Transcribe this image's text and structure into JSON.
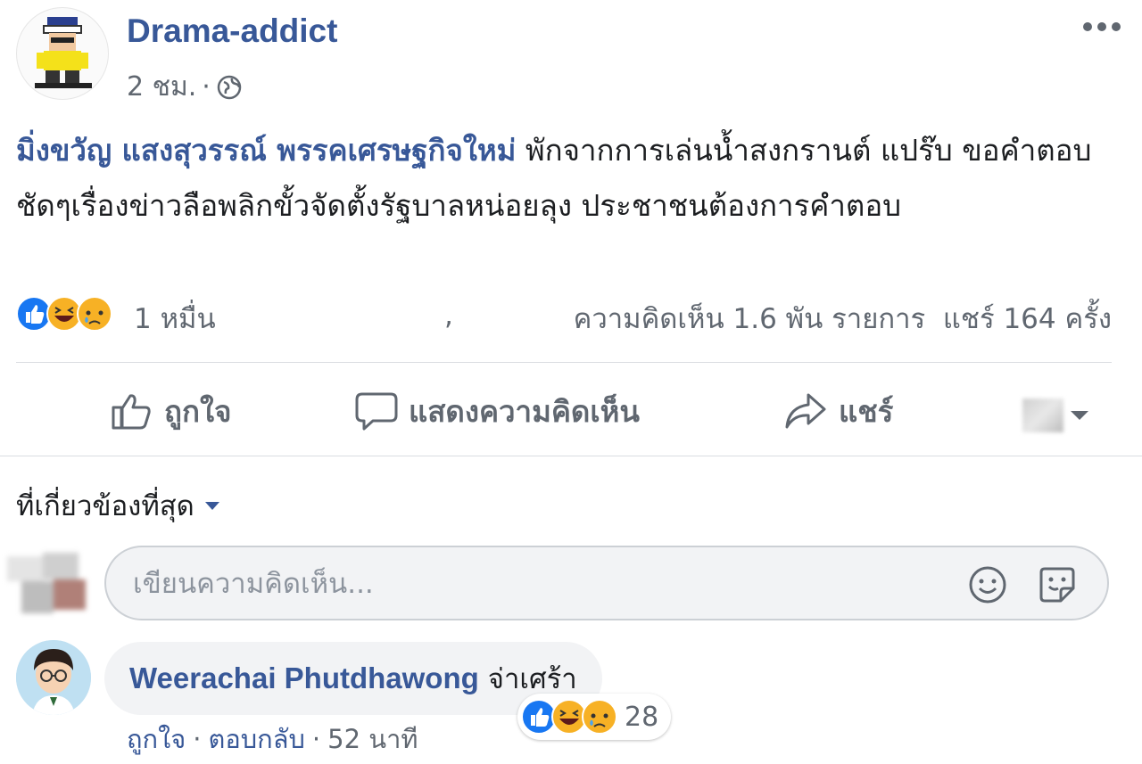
{
  "post": {
    "author": "Drama-addict",
    "time": "2 ชม.",
    "separator": "·",
    "privacy_icon": "globe-icon",
    "tag": "มิ่งขวัญ แสงสุวรรณ์ พรรคเศรษฐกิจใหม่",
    "body": " พักจากการเล่นน้ำสงกรานต์ แปร๊บ ขอคำตอบชัดๆเรื่องข่าวลือพลิกขั้วจัดตั้งรัฐบาลหน่อยลุง ประชาชนต้องการคำตอบ"
  },
  "stats": {
    "reaction_icons": [
      "like-icon",
      "haha-icon",
      "sad-icon"
    ],
    "reaction_count": "1 หมื่น",
    "stray": ",",
    "comments": "ความคิดเห็น 1.6 พัน รายการ",
    "shares": "แชร์ 164 ครั้ง"
  },
  "actions": {
    "like": "ถูกใจ",
    "comment": "แสดงความคิดเห็น",
    "share": "แชร์"
  },
  "comments_section": {
    "sort_label": "ที่เกี่ยวข้องที่สุด",
    "input_placeholder": "เขียนความคิดเห็น..."
  },
  "comment": {
    "author": "Weerachai Phutdhawong",
    "text": "จ่าเศร้า",
    "reaction_icons": [
      "like-icon",
      "haha-icon",
      "sad-icon"
    ],
    "reaction_count": "28",
    "like_label": "ถูกใจ",
    "reply_label": "ตอบกลับ",
    "sep": "·",
    "time": "52 นาที"
  },
  "colors": {
    "link": "#385898",
    "meta": "#606770",
    "like": "#1877f2",
    "emoji": "#f7b125"
  }
}
